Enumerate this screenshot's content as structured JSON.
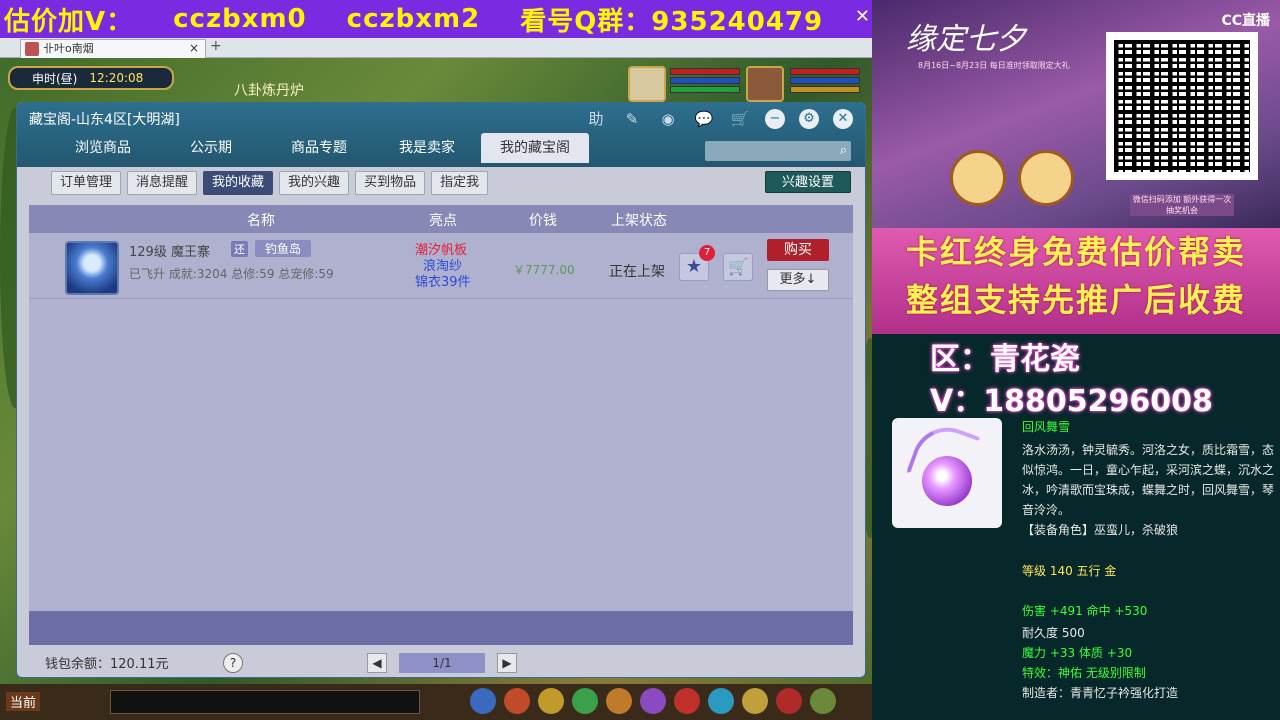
{
  "overlay": {
    "banner_text": [
      "估价加V：",
      "cczbxm0",
      "cczbxm2",
      "看号Q群：935240479"
    ],
    "close": "✕"
  },
  "browser": {
    "tab_title": "卝叶o南烟",
    "tab_close": "×",
    "new_tab": "+"
  },
  "hud": {
    "time_label": "申时(昼)",
    "time_value": "12:20:08",
    "location_sign": "八卦炼丹炉"
  },
  "window": {
    "title": "藏宝阁-山东4区[大明湖]",
    "controls": [
      "助",
      "✎",
      "◉",
      "💬",
      "🛒"
    ],
    "tabs": [
      {
        "label": "浏览商品",
        "active": false
      },
      {
        "label": "公示期",
        "active": false
      },
      {
        "label": "商品专题",
        "active": false
      },
      {
        "label": "我是卖家",
        "active": false
      },
      {
        "label": "我的藏宝阁",
        "active": true
      }
    ],
    "search_placeholder": "",
    "subtabs": [
      {
        "label": "订单管理",
        "active": false
      },
      {
        "label": "消息提醒",
        "active": false
      },
      {
        "label": "我的收藏",
        "active": true
      },
      {
        "label": "我的兴趣",
        "active": false
      },
      {
        "label": "买到物品",
        "active": false
      },
      {
        "label": "指定我",
        "active": false
      }
    ],
    "interest_settings": "兴趣设置",
    "columns": [
      "名称",
      "亮点",
      "价钱",
      "上架状态"
    ],
    "row": {
      "level_name": "129级  魔王寨",
      "badge": "还",
      "location": "钓鱼岛",
      "stats": "已飞升  成就:3204  总修:59  总宠修:59",
      "highlights": [
        "潮汐帆板",
        "浪淘纱",
        "锦衣39件"
      ],
      "price": "￥7777.00",
      "status": "正在上架",
      "fav_count": "7",
      "buy": "购买",
      "more": "更多↓"
    },
    "wallet": "钱包余额：120.11元",
    "help": "?",
    "page": "1/1",
    "prev": "◀",
    "next": "▶"
  },
  "bottom_bar": {
    "current_channel": "当前"
  },
  "promo": {
    "event_title": "缘定七夕",
    "event_sub": "8月16日~8月23日 每日准时领取限定大礼",
    "brand": "CC直播",
    "qr_note": "微信扫码添加 额外获得一次抽奖机会"
  },
  "slogan": {
    "line1": "卡红终身免费估价帮卖",
    "line2": "整组支持先推广后收费"
  },
  "contact": {
    "zone": "区：青花瓷",
    "wechat": "V：18805296008"
  },
  "item_detail": {
    "name": "回风舞雪",
    "description": "洛水汤汤，钟灵毓秀。河洛之女，质比霜雪，态似惊鸿。一日，童心乍起，采河滨之蝶，沉水之冰，吟清歌而宝珠成，蝶舞之时，回风舞雪，琴音泠泠。",
    "equip_roles": "【装备角色】巫蛮儿，杀破狼",
    "level_line": "等级 140  五行 金",
    "attack_line": "伤害 +491  命中 +530",
    "durability_line": "耐久度 500",
    "magic_line": "魔力 +33  体质 +30",
    "special_line": "特效：神佑  无级别限制",
    "maker_line": "制造者：青青忆子衿强化打造"
  }
}
